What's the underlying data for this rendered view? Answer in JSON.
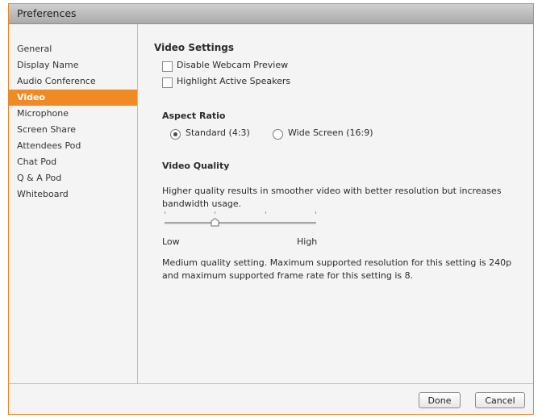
{
  "window": {
    "title": "Preferences"
  },
  "sidebar": {
    "items": [
      {
        "label": "General"
      },
      {
        "label": "Display Name"
      },
      {
        "label": "Audio Conference"
      },
      {
        "label": "Video",
        "selected": true
      },
      {
        "label": "Microphone"
      },
      {
        "label": "Screen Share"
      },
      {
        "label": "Attendees Pod"
      },
      {
        "label": "Chat Pod"
      },
      {
        "label": "Q & A Pod"
      },
      {
        "label": "Whiteboard"
      }
    ]
  },
  "video_settings": {
    "heading": "Video Settings",
    "disable_webcam_preview": {
      "label": "Disable Webcam Preview",
      "checked": false
    },
    "highlight_active_speakers": {
      "label": "Highlight Active Speakers",
      "checked": false
    }
  },
  "aspect_ratio": {
    "heading": "Aspect Ratio",
    "options": [
      {
        "label": "Standard (4:3)",
        "selected": true
      },
      {
        "label": "Wide Screen (16:9)",
        "selected": false
      }
    ]
  },
  "video_quality": {
    "heading": "Video Quality",
    "description": "Higher quality results in smoother video with better resolution but increases bandwidth usage.",
    "slider": {
      "min_label": "Low",
      "max_label": "High",
      "position": 1,
      "steps": 4
    },
    "status": "Medium quality setting. Maximum supported resolution for this setting is 240p and maximum supported frame rate for this setting is 8."
  },
  "footer": {
    "done_label": "Done",
    "cancel_label": "Cancel"
  },
  "colors": {
    "accent": "#f08a24",
    "border": "#e8872a"
  }
}
